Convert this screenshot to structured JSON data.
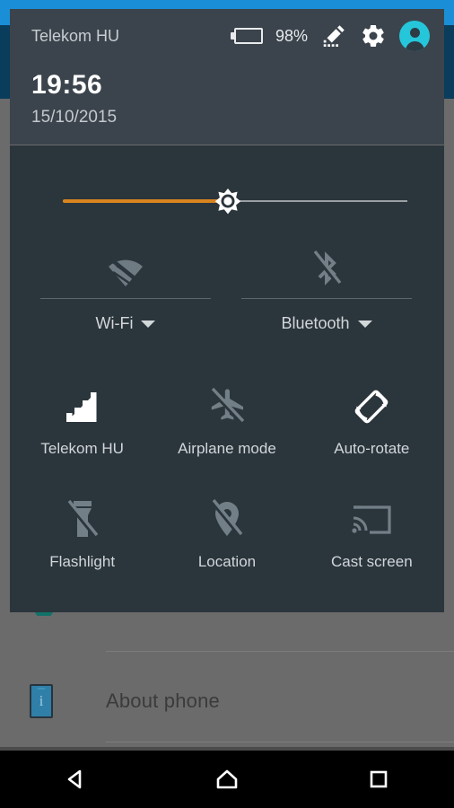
{
  "background_app": {
    "rows": [
      {
        "label": "About phone",
        "icon": "phone-info-icon",
        "icon_glyph": "i"
      }
    ]
  },
  "shade": {
    "header": {
      "carrier": "Telekom HU",
      "battery_percent": "98%",
      "battery_icon": "battery-icon",
      "edit_icon": "edit-pencil-icon",
      "settings_icon": "gear-icon",
      "user_icon": "user-avatar-icon",
      "clock": "19:56",
      "date": "15/10/2015"
    },
    "brightness": {
      "name": "brightness-slider",
      "value_percent": 48,
      "fill_color": "#d8841f",
      "track_color": "#9aa0a4",
      "thumb_icon": "brightness-sun-icon"
    },
    "pair_tiles": [
      {
        "label": "Wi-Fi",
        "icon": "wifi-off-icon",
        "state": "off",
        "has_dropdown": true
      },
      {
        "label": "Bluetooth",
        "icon": "bluetooth-off-icon",
        "state": "off",
        "has_dropdown": true
      }
    ],
    "tiles": [
      {
        "label": "Telekom HU",
        "icon": "signal-bars-icon",
        "state": "on"
      },
      {
        "label": "Airplane mode",
        "icon": "airplane-off-icon",
        "state": "off"
      },
      {
        "label": "Auto-rotate",
        "icon": "auto-rotate-icon",
        "state": "on"
      },
      {
        "label": "Flashlight",
        "icon": "flashlight-off-icon",
        "state": "off"
      },
      {
        "label": "Location",
        "icon": "location-off-icon",
        "state": "off"
      },
      {
        "label": "Cast screen",
        "icon": "cast-screen-icon",
        "state": "off"
      }
    ]
  },
  "navbar": {
    "back": "back-nav-icon",
    "home": "home-nav-icon",
    "recents": "recents-nav-icon"
  },
  "colors": {
    "status_bar": "#1a8fd8",
    "action_bar": "#0a3c5c",
    "shade_header": "#3b444c",
    "shade_panel": "#2b353c",
    "accent_orange": "#d8841f",
    "avatar_cyan": "#26c6da",
    "icon_active": "#ffffff",
    "icon_inactive": "#737f87"
  }
}
